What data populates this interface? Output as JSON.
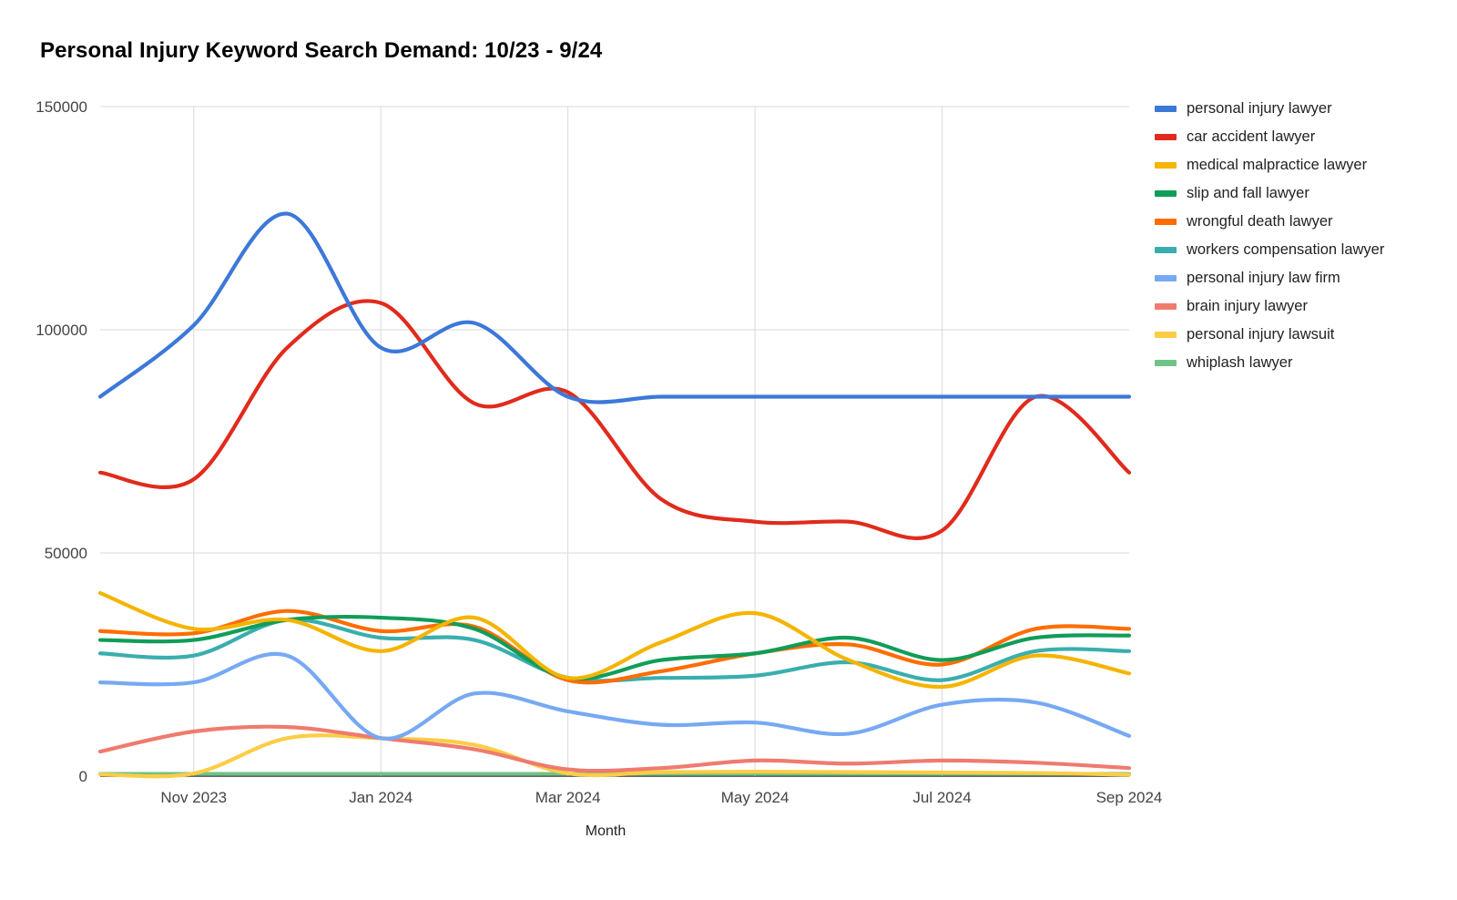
{
  "chart_data": {
    "type": "line",
    "title": "Personal Injury Keyword Search Demand: 10/23 - 9/24",
    "xlabel": "Month",
    "ylabel": "",
    "ylim": [
      0,
      150000
    ],
    "ytick_labels": [
      "0",
      "50000",
      "100000",
      "150000"
    ],
    "yticks": [
      0,
      50000,
      100000,
      150000
    ],
    "grid": true,
    "legend_position": "right",
    "x": [
      "Oct 2023",
      "Nov 2023",
      "Dec 2023",
      "Jan 2024",
      "Feb 2024",
      "Mar 2024",
      "Apr 2024",
      "May 2024",
      "Jun 2024",
      "Jul 2024",
      "Aug 2024",
      "Sep 2024"
    ],
    "xtick_labels": [
      "Nov 2023",
      "Jan 2024",
      "Mar 2024",
      "May 2024",
      "Jul 2024",
      "Sep 2024"
    ],
    "xtick_indices": [
      1,
      3,
      5,
      7,
      9,
      11
    ],
    "series": [
      {
        "name": "personal injury lawyer",
        "color": "#3c78d8",
        "values": [
          85000,
          101000,
          126000,
          96000,
          101500,
          85000,
          85000,
          85000,
          85000,
          85000,
          85000,
          85000
        ]
      },
      {
        "name": "car accident lawyer",
        "color": "#e02b1c",
        "values": [
          68000,
          66500,
          96000,
          106000,
          83500,
          86000,
          62000,
          57000,
          57000,
          55000,
          85000,
          68000
        ]
      },
      {
        "name": "medical malpractice lawyer",
        "color": "#f5b400",
        "values": [
          41000,
          33000,
          35000,
          28000,
          35500,
          22000,
          30000,
          36500,
          26000,
          20000,
          27000,
          23000
        ]
      },
      {
        "name": "slip and fall lawyer",
        "color": "#109d58",
        "values": [
          30500,
          30500,
          35000,
          35500,
          33000,
          22000,
          26000,
          27500,
          31000,
          26000,
          31000,
          31500
        ]
      },
      {
        "name": "wrongful death lawyer",
        "color": "#ff6d01",
        "values": [
          32500,
          32000,
          37000,
          32500,
          33500,
          21500,
          23500,
          27500,
          29500,
          25000,
          33000,
          33000
        ]
      },
      {
        "name": "workers compensation lawyer",
        "color": "#3aaeae",
        "values": [
          27500,
          27000,
          35000,
          31000,
          30500,
          22000,
          22000,
          22500,
          25500,
          21500,
          28000,
          28000
        ]
      },
      {
        "name": "personal injury law firm",
        "color": "#77a9f3"
      },
      {
        "name": "brain injury lawyer",
        "color": "#ef7b6f"
      },
      {
        "name": "personal injury lawsuit",
        "color": "#fccd45"
      },
      {
        "name": "whiplash lawyer",
        "color": "#71c287"
      }
    ],
    "series_extra": [
      {
        "name": "personal injury law firm",
        "color": "#77a9f3",
        "values": [
          21000,
          21000,
          27000,
          8500,
          18500,
          14500,
          11500,
          12000,
          9500,
          16000,
          16500,
          9000
        ]
      },
      {
        "name": "brain injury lawyer",
        "color": "#ef7b6f",
        "values": [
          5500,
          10000,
          11000,
          8500,
          6000,
          1500,
          1800,
          3500,
          2800,
          3500,
          3000,
          1800
        ]
      },
      {
        "name": "personal injury lawsuit",
        "color": "#fccd45",
        "values": [
          400,
          600,
          8500,
          8500,
          7000,
          600,
          900,
          1000,
          900,
          800,
          700,
          300
        ]
      },
      {
        "name": "whiplash lawyer",
        "color": "#71c287",
        "values": [
          500,
          500,
          500,
          500,
          500,
          500,
          500,
          500,
          500,
          500,
          500,
          500
        ]
      }
    ]
  },
  "legend": {
    "items": [
      {
        "label": "personal injury lawyer",
        "color": "#3c78d8"
      },
      {
        "label": "car accident lawyer",
        "color": "#e02b1c"
      },
      {
        "label": "medical malpractice lawyer",
        "color": "#f5b400"
      },
      {
        "label": "slip and fall lawyer",
        "color": "#109d58"
      },
      {
        "label": "wrongful death lawyer",
        "color": "#ff6d01"
      },
      {
        "label": "workers compensation lawyer",
        "color": "#3aaeae"
      },
      {
        "label": "personal injury law firm",
        "color": "#77a9f3"
      },
      {
        "label": "brain injury lawyer",
        "color": "#ef7b6f"
      },
      {
        "label": "personal injury lawsuit",
        "color": "#fccd45"
      },
      {
        "label": "whiplash lawyer",
        "color": "#71c287"
      }
    ]
  }
}
